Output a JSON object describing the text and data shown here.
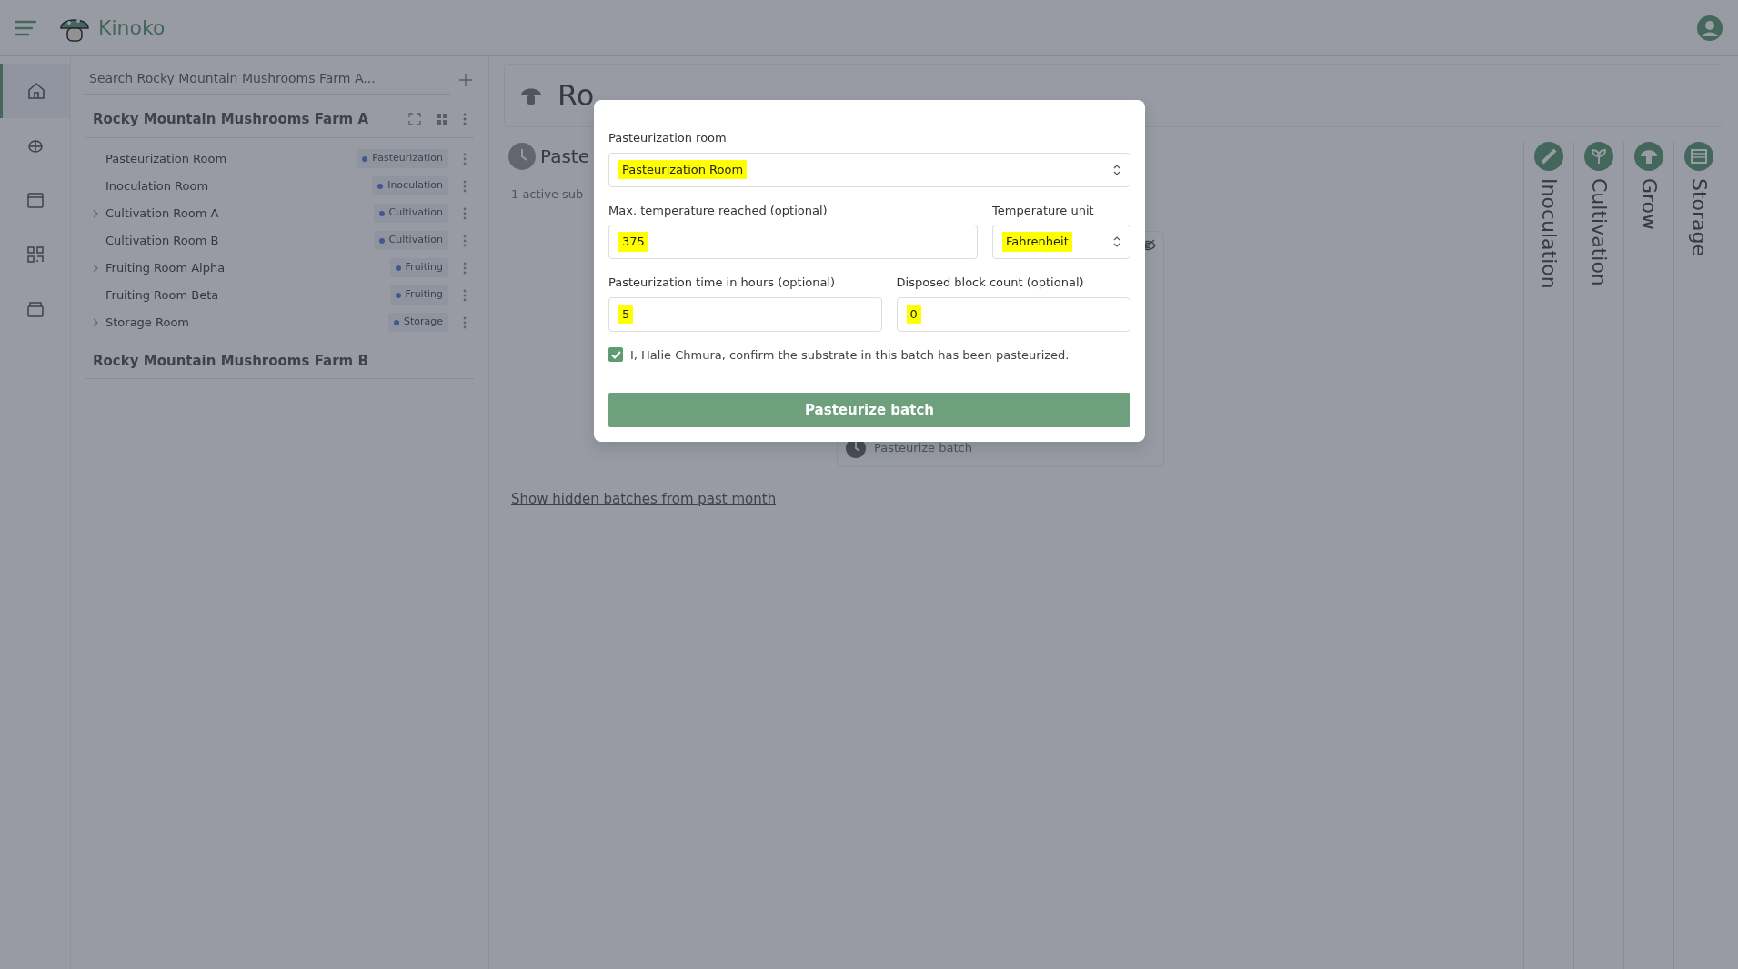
{
  "app": {
    "title": "Kinoko"
  },
  "rail": [
    {
      "kind": "home",
      "selected": true
    },
    {
      "kind": "bug",
      "selected": false
    },
    {
      "kind": "calendar",
      "selected": false
    },
    {
      "kind": "qr",
      "selected": false
    },
    {
      "kind": "box",
      "selected": false
    }
  ],
  "tree": {
    "search_placeholder": "Search Rocky Mountain Mushrooms Farm A...",
    "farms": [
      {
        "name": "Rocky Mountain Mushrooms Farm A",
        "children": [
          {
            "name": "Pasteurization Room",
            "tag": "Pasteurization",
            "expandable": false
          },
          {
            "name": "Inoculation Room",
            "tag": "Inoculation",
            "expandable": false
          },
          {
            "name": "Cultivation Room A",
            "tag": "Cultivation",
            "expandable": true
          },
          {
            "name": "Cultivation Room B",
            "tag": "Cultivation",
            "expandable": false
          },
          {
            "name": "Fruiting Room Alpha",
            "tag": "Fruiting",
            "expandable": true
          },
          {
            "name": "Fruiting Room Beta",
            "tag": "Fruiting",
            "expandable": false
          },
          {
            "name": "Storage Room",
            "tag": "Storage",
            "expandable": true
          }
        ]
      },
      {
        "name": "Rocky Mountain Mushrooms Farm B"
      }
    ]
  },
  "main": {
    "title": "Ro",
    "section_title": "Paste",
    "subtitle": "1 active sub",
    "batch_action": "Pasteurize batch",
    "link": "Show hidden batches from past month"
  },
  "stages": [
    {
      "kind": "inoculation",
      "label": "Inoculation"
    },
    {
      "kind": "cultivation",
      "label": "Cultivation"
    },
    {
      "kind": "grow",
      "label": "Grow"
    },
    {
      "kind": "storage",
      "label": "Storage"
    }
  ],
  "modal": {
    "fields": [
      {
        "kind": "select",
        "label": "Pasteurization room",
        "value": "Pasteurization Room",
        "highlighted": true
      },
      {
        "kind": "input",
        "label": "Max. temperature reached (optional)",
        "value": "375",
        "highlighted": true
      },
      {
        "kind": "select",
        "label": "Temperature unit",
        "value": "Fahrenheit",
        "highlighted": true
      },
      {
        "kind": "input",
        "label": "Pasteurization time in hours (optional)",
        "value": "5",
        "highlighted": true
      },
      {
        "kind": "input",
        "label": "Disposed block count (optional)",
        "value": "0",
        "highlighted": true
      }
    ],
    "confirm": {
      "text": "I, Halie Chmura, confirm the substrate in this batch has been pasteurized.",
      "checked": true
    },
    "submit": "Pasteurize batch"
  }
}
